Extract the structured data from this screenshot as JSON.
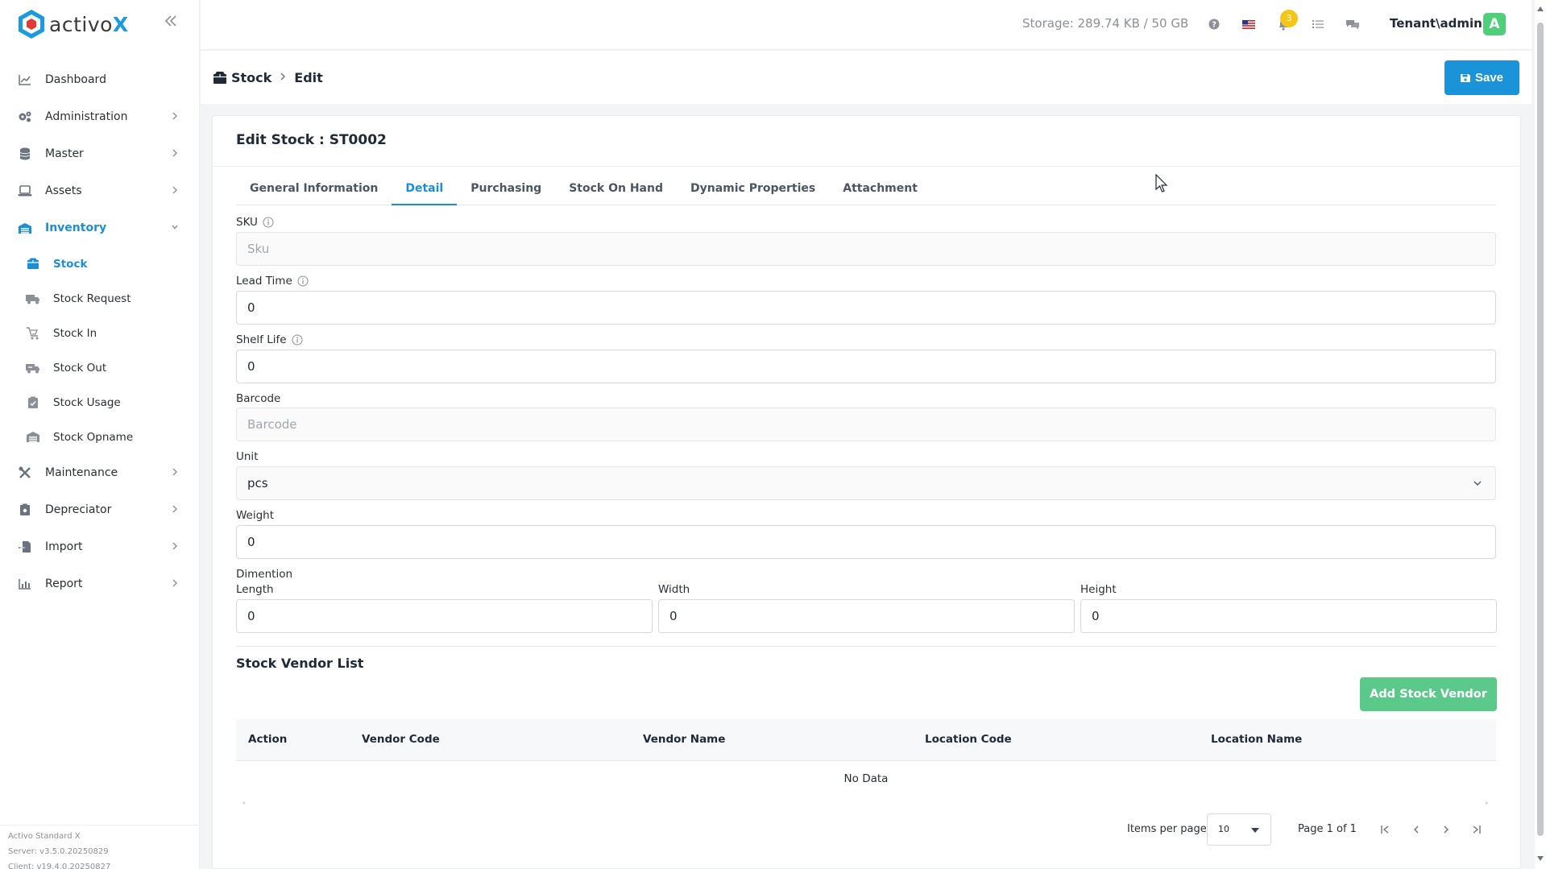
{
  "brand": {
    "name_prefix": "activo",
    "name_suffix": "X"
  },
  "colors": {
    "accent": "#1a93d9",
    "success": "#5bc98a",
    "avatar": "#4fcf7a",
    "badge": "#f5c518"
  },
  "sidebar": {
    "collapse_icon": "double-chevron-left-icon",
    "items": [
      {
        "label": "Dashboard",
        "icon": "chart-line-icon"
      },
      {
        "label": "Administration",
        "icon": "gears-icon"
      },
      {
        "label": "Master",
        "icon": "database-icon"
      },
      {
        "label": "Assets",
        "icon": "laptop-icon"
      },
      {
        "label": "Inventory",
        "icon": "warehouse-icon"
      },
      {
        "label": "Maintenance",
        "icon": "tools-icon"
      },
      {
        "label": "Depreciator",
        "icon": "clipboard-icon"
      },
      {
        "label": "Import",
        "icon": "file-import-icon"
      },
      {
        "label": "Report",
        "icon": "bar-chart-icon"
      }
    ],
    "inventory_sub": [
      {
        "label": "Stock",
        "icon": "box-icon"
      },
      {
        "label": "Stock Request",
        "icon": "truck-icon"
      },
      {
        "label": "Stock In",
        "icon": "cart-icon"
      },
      {
        "label": "Stock Out",
        "icon": "truck-out-icon"
      },
      {
        "label": "Stock Usage",
        "icon": "clipboard-check-icon"
      },
      {
        "label": "Stock Opname",
        "icon": "warehouse-icon"
      }
    ],
    "version": {
      "product": "Activo Standard X",
      "server": "Server: v3.5.0.20250829",
      "client": "Client: v19.4.0.20250827"
    }
  },
  "topbar": {
    "storage": "Storage: 289.74 KB / 50 GB",
    "notification_count": "3",
    "user": "Tenant\\admin",
    "avatar_letter": "A"
  },
  "breadcrumb": {
    "root": "Stock",
    "current": "Edit"
  },
  "toolbar": {
    "save_label": "Save"
  },
  "card": {
    "title": "Edit Stock : ST0002",
    "tabs": [
      "General Information",
      "Detail",
      "Purchasing",
      "Stock On Hand",
      "Dynamic Properties",
      "Attachment"
    ],
    "active_tab": "Detail"
  },
  "form": {
    "sku": {
      "label": "SKU",
      "value": "",
      "placeholder": "Sku"
    },
    "lead_time": {
      "label": "Lead Time",
      "value": "0"
    },
    "shelf_life": {
      "label": "Shelf Life",
      "value": "0"
    },
    "barcode": {
      "label": "Barcode",
      "value": "",
      "placeholder": "Barcode"
    },
    "unit": {
      "label": "Unit",
      "value": "pcs"
    },
    "weight": {
      "label": "Weight",
      "value": "0"
    },
    "dimension": {
      "label": "Dimention",
      "length": {
        "label": "Length",
        "value": "0"
      },
      "width": {
        "label": "Width",
        "value": "0"
      },
      "height": {
        "label": "Height",
        "value": "0"
      }
    }
  },
  "vendor_list": {
    "title": "Stock Vendor List",
    "add_label": "Add Stock Vendor",
    "columns": [
      "Action",
      "Vendor Code",
      "Vendor Name",
      "Location Code",
      "Location Name"
    ],
    "empty_text": "No Data"
  },
  "pagination": {
    "items_per_page_label": "Items per page",
    "items_per_page": "10",
    "page_info": "Page 1 of 1"
  }
}
